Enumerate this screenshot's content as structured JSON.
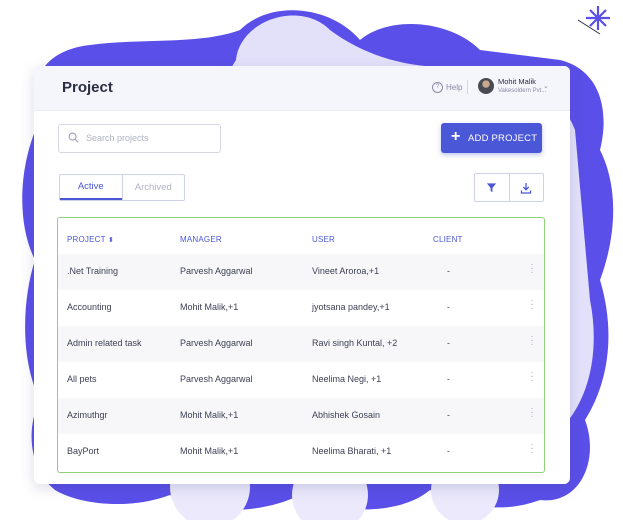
{
  "colors": {
    "accent": "#4a57d6",
    "blob": "#5a4fe8",
    "blob_light": "#ebe9fb",
    "table_border": "#8fd07b"
  },
  "header": {
    "title": "Project",
    "help_label": "Help",
    "user_name": "Mohit Malik",
    "user_sub": "Vakesoldern Pvt..."
  },
  "search": {
    "placeholder": "Search projects"
  },
  "add_button": {
    "label": "ADD PROJECT",
    "icon": "plus-icon"
  },
  "tabs": [
    {
      "label": "Active",
      "active": true
    },
    {
      "label": "Archived",
      "active": false
    }
  ],
  "tools": {
    "filter_icon": "filter-icon",
    "download_icon": "download-icon"
  },
  "table": {
    "headers": [
      "PROJECT",
      "MANAGER",
      "USER",
      "CLIENT"
    ],
    "sort_icon": "sort-icon",
    "rows": [
      {
        "project": ".Net Training",
        "manager": "Parvesh Aggarwal",
        "user": "Vineet Aroroa,+1",
        "client": "-"
      },
      {
        "project": "Accounting",
        "manager": "Mohit Malik,+1",
        "user": "jyotsana pandey,+1",
        "client": "-"
      },
      {
        "project": "Admin related task",
        "manager": "Parvesh Aggarwal",
        "user": "Ravi singh Kuntal, +2",
        "client": "-"
      },
      {
        "project": "All pets",
        "manager": "Parvesh Aggarwal",
        "user": "Neelima Negi, +1",
        "client": "-"
      },
      {
        "project": "Azimuthgr",
        "manager": "Mohit Malik,+1",
        "user": "Abhishek Gosain",
        "client": "-"
      },
      {
        "project": "BayPort",
        "manager": "Mohit Malik,+1",
        "user": "Neelima Bharati, +1",
        "client": "-"
      }
    ]
  }
}
